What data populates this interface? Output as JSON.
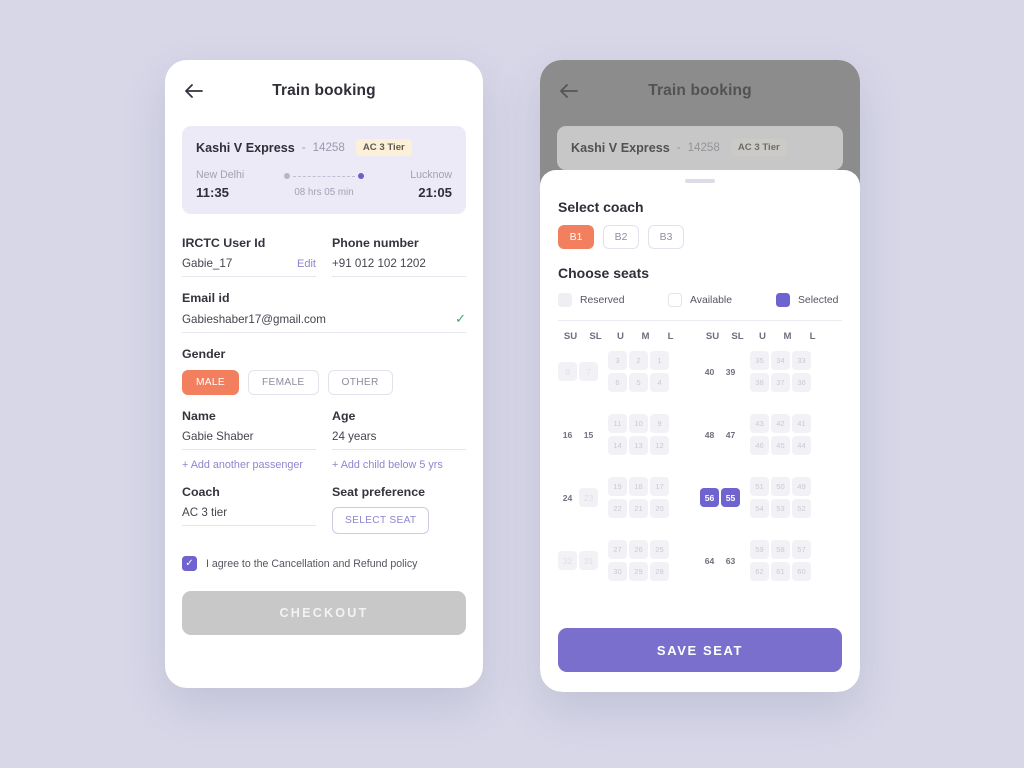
{
  "page": {
    "background_color": "#d7d7e8"
  },
  "theme": {
    "accent_orange": "#f2805e",
    "accent_purple": "#6f63cf",
    "badge_cream": "#fcf0d8",
    "card_lavender": "#eceaf6",
    "disabled_gray": "#c8c8c8",
    "check_green": "#3fa86b"
  },
  "screen_left": {
    "header": {
      "back_icon": "arrow-left-icon",
      "title": "Train booking"
    },
    "train_card": {
      "name": "Kashi V Express",
      "dash": "-",
      "number": "14258",
      "class_badge": "AC 3 Tier",
      "from_city": "New Delhi",
      "from_time": "11:35",
      "duration": "08 hrs 05 min",
      "to_city": "Lucknow",
      "to_time": "21:05"
    },
    "fields": {
      "irctc_label": "IRCTC User Id",
      "irctc_value": "Gabie_17",
      "edit_label": "Edit",
      "phone_label": "Phone number",
      "phone_value": "+91 012 102 1202",
      "email_label": "Email id",
      "email_value": "Gabieshaber17@gmail.com",
      "email_verified_icon": "check-icon",
      "gender_label": "Gender",
      "name_label": "Name",
      "name_value": "Gabie Shaber",
      "age_label": "Age",
      "age_value": "24 years",
      "add_passenger": "+ Add another passenger",
      "add_child": "+ Add child below 5 yrs",
      "coach_label": "Coach",
      "coach_value": "AC 3 tier",
      "seat_pref_label": "Seat preference",
      "select_seat_button": "SELECT SEAT"
    },
    "gender_options": [
      {
        "label": "MALE",
        "selected": true
      },
      {
        "label": "FEMALE",
        "selected": false
      },
      {
        "label": "OTHER",
        "selected": false
      }
    ],
    "agree": {
      "checked": true,
      "text": "I agree to the Cancellation and Refund policy"
    },
    "checkout_button": {
      "label": "CHECKOUT",
      "enabled": false
    }
  },
  "screen_right": {
    "header": {
      "back_icon": "arrow-left-icon",
      "title": "Train booking"
    },
    "train_card": {
      "name": "Kashi V Express",
      "dash": "-",
      "number": "14258",
      "class_badge": "AC 3 Tier"
    },
    "sheet": {
      "select_coach_title": "Select coach",
      "coaches": [
        {
          "label": "B1",
          "selected": true
        },
        {
          "label": "B2",
          "selected": false
        },
        {
          "label": "B3",
          "selected": false
        }
      ],
      "choose_seats_title": "Choose seats",
      "legend": [
        {
          "label": "Reserved",
          "state": "reserved"
        },
        {
          "label": "Available",
          "state": "available"
        },
        {
          "label": "Selected",
          "state": "selected"
        }
      ],
      "column_headers": [
        "SU",
        "SL",
        "U",
        "M",
        "L"
      ],
      "seat_blocks": [
        {
          "bays": [
            {
              "side": [
                "8",
                "7"
              ],
              "side_state": [
                "reserved",
                "reserved"
              ],
              "rows": [
                [
                  "3",
                  "2",
                  "1"
                ],
                [
                  "6",
                  "5",
                  "4"
                ]
              ]
            },
            {
              "side": [
                "16",
                "15"
              ],
              "side_state": [
                "available",
                "available"
              ],
              "rows": [
                [
                  "11",
                  "10",
                  "9"
                ],
                [
                  "14",
                  "13",
                  "12"
                ]
              ]
            },
            {
              "side": [
                "24",
                "23"
              ],
              "side_state": [
                "available",
                "reserved"
              ],
              "rows": [
                [
                  "19",
                  "18",
                  "17"
                ],
                [
                  "22",
                  "21",
                  "20"
                ]
              ]
            },
            {
              "side": [
                "32",
                "31"
              ],
              "side_state": [
                "reserved",
                "reserved"
              ],
              "rows": [
                [
                  "27",
                  "26",
                  "25"
                ],
                [
                  "30",
                  "29",
                  "28"
                ]
              ]
            }
          ]
        },
        {
          "bays": [
            {
              "side": [
                "40",
                "39"
              ],
              "side_state": [
                "available",
                "available"
              ],
              "rows": [
                [
                  "35",
                  "34",
                  "33"
                ],
                [
                  "38",
                  "37",
                  "36"
                ]
              ]
            },
            {
              "side": [
                "48",
                "47"
              ],
              "side_state": [
                "available",
                "available"
              ],
              "rows": [
                [
                  "43",
                  "42",
                  "41"
                ],
                [
                  "46",
                  "45",
                  "44"
                ]
              ]
            },
            {
              "side": [
                "56",
                "55"
              ],
              "side_state": [
                "selected",
                "selected"
              ],
              "rows": [
                [
                  "51",
                  "50",
                  "49"
                ],
                [
                  "54",
                  "53",
                  "52"
                ]
              ]
            },
            {
              "side": [
                "64",
                "63"
              ],
              "side_state": [
                "available",
                "available"
              ],
              "rows": [
                [
                  "59",
                  "58",
                  "57"
                ],
                [
                  "62",
                  "61",
                  "60"
                ]
              ]
            }
          ]
        }
      ],
      "save_button": "SAVE SEAT"
    }
  }
}
